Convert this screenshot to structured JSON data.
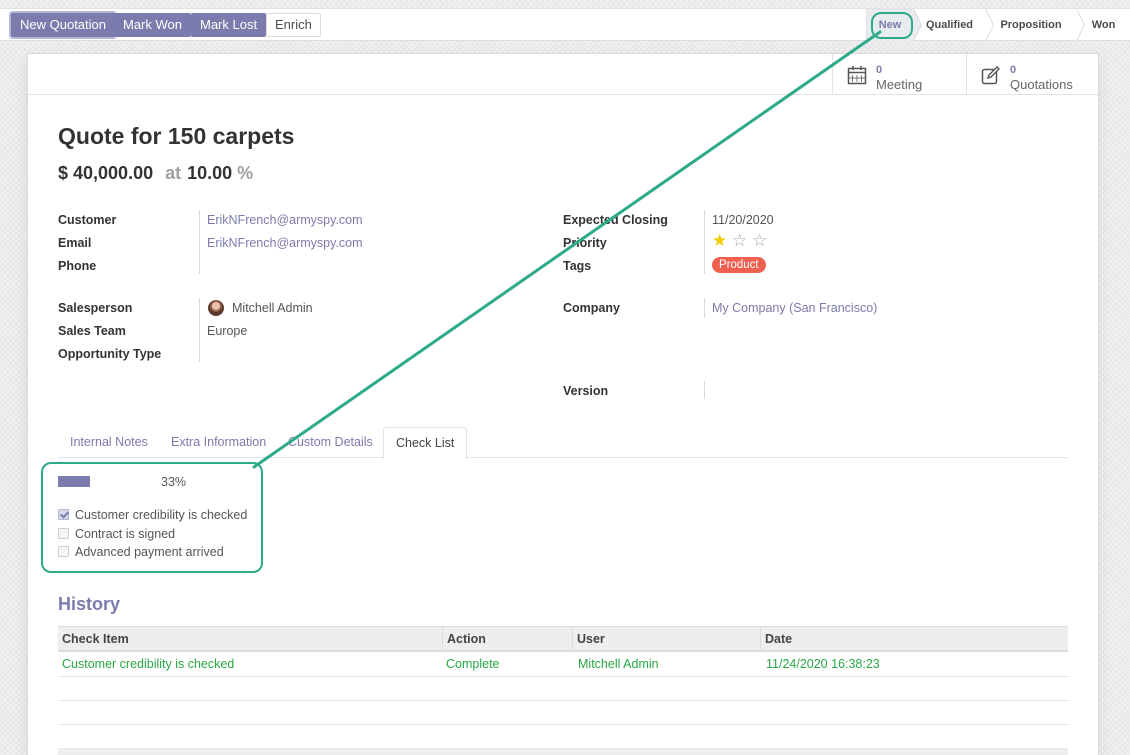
{
  "toolbar": {
    "new_quotation": "New Quotation",
    "mark_won": "Mark Won",
    "mark_lost": "Mark Lost",
    "enrich": "Enrich"
  },
  "stages": [
    "New",
    "Qualified",
    "Proposition",
    "Won"
  ],
  "stats": {
    "meetings": {
      "count": "0",
      "label": "Meeting",
      "icon": "calendar-icon"
    },
    "quotations": {
      "count": "0",
      "label": "Quotations",
      "icon": "edit-icon"
    }
  },
  "record": {
    "title": "Quote for 150 carpets",
    "revenue": "$ 40,000.00",
    "at": "at",
    "probability": "10.00",
    "percent": "%"
  },
  "fields": {
    "customer_label": "Customer",
    "customer": "ErikNFrench@armyspy.com",
    "email_label": "Email",
    "email": "ErikNFrench@armyspy.com",
    "phone_label": "Phone",
    "salesperson_label": "Salesperson",
    "salesperson": "Mitchell Admin",
    "team_label": "Sales Team",
    "team": "Europe",
    "opp_type_label": "Opportunity Type",
    "closing_label": "Expected Closing",
    "closing": "11/20/2020",
    "priority_label": "Priority",
    "priority": 1,
    "priority_max": 3,
    "tags_label": "Tags",
    "tag": "Product",
    "company_label": "Company",
    "company": "My Company (San Francisco)",
    "version_label": "Version"
  },
  "tabs": [
    "Internal Notes",
    "Extra Information",
    "Custom Details",
    "Check List"
  ],
  "checklist": {
    "progress_text": "33%",
    "progress": 0.33,
    "items": [
      {
        "label": "Customer credibility is checked",
        "checked": true
      },
      {
        "label": "Contract is signed",
        "checked": false
      },
      {
        "label": "Advanced payment arrived",
        "checked": false
      }
    ]
  },
  "history": {
    "title": "History",
    "columns": [
      "Check Item",
      "Action",
      "User",
      "Date"
    ],
    "rows": [
      [
        "Customer credibility is checked",
        "Complete",
        "Mitchell Admin",
        "11/24/2020 16:38:23"
      ]
    ]
  },
  "colors": {
    "primary": "#7c7bad",
    "highlight": "#2eaa8a",
    "tag": "#f06050",
    "success": "#28a745"
  }
}
